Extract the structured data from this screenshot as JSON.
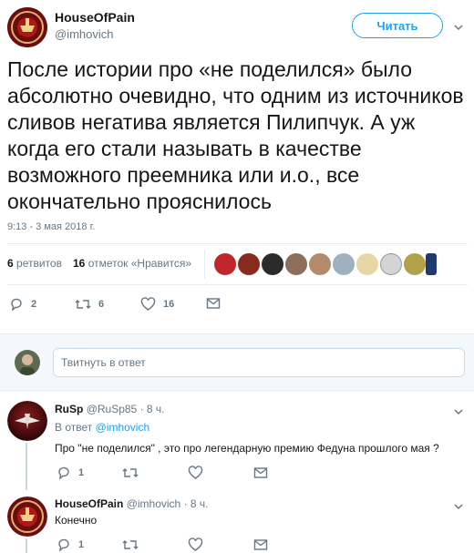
{
  "author": {
    "name": "HouseOfPain",
    "handle": "@imhovich"
  },
  "follow_label": "Читать",
  "tweet": {
    "text": "После истории про «не поделился» было абсолютно очевидно, что одним из источников сливов негатива является Пилипчук. А уж когда его стали называть в качестве возможного преемника или и.о., все окончательно прояснилось",
    "timestamp": "9:13 - 3 мая 2018 г."
  },
  "stats": {
    "retweets_count": "6",
    "retweets_label": "ретвитов",
    "likes_count": "16",
    "likes_label": "отметок «Нравится»"
  },
  "actions": {
    "reply_count": "2",
    "retweet_count": "6",
    "like_count": "16"
  },
  "compose": {
    "placeholder": "Твитнуть в ответ"
  },
  "replies": [
    {
      "name": "RuSp",
      "handle": "@RuSp85",
      "time": "· 8 ч.",
      "reply_to_prefix": "В ответ",
      "reply_to_handle": "@imhovich",
      "text": "Про \"не поделился\" , это про легендарную премию Федуна прошлого мая ?",
      "reply_count": "1"
    },
    {
      "name": "HouseOfPain",
      "handle": "@imhovich",
      "time": "· 8 ч.",
      "text": "Конечно",
      "reply_count": "1"
    }
  ],
  "colors": {
    "accent": "#1da1f2",
    "muted": "#657786",
    "divider": "#e6ecf0",
    "compose_bg": "#f5f8fa"
  }
}
